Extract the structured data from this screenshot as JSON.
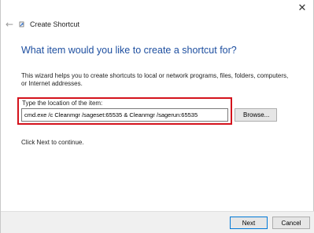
{
  "window": {
    "close_glyph": "✕",
    "back_glyph": "←",
    "title": "Create Shortcut"
  },
  "page": {
    "heading": "What item would you like to create a shortcut for?",
    "description": "This wizard helps you to create shortcuts to local or network programs, files, folders, computers, or Internet addresses.",
    "location_label": "Type the location of the item:",
    "location_value": "cmd.exe /c Cleanmgr /sageset:65535 & Cleanmgr /sagerun:65535",
    "browse_label": "Browse...",
    "hint": "Click Next to continue."
  },
  "buttons": {
    "next": "Next",
    "cancel": "Cancel"
  },
  "colors": {
    "heading": "#1e4fa0",
    "highlight": "#d4121c",
    "default_button_border": "#0078d7"
  },
  "icons": {
    "close": "close-icon",
    "back": "back-arrow-icon",
    "wizard": "shortcut-wizard-icon"
  }
}
